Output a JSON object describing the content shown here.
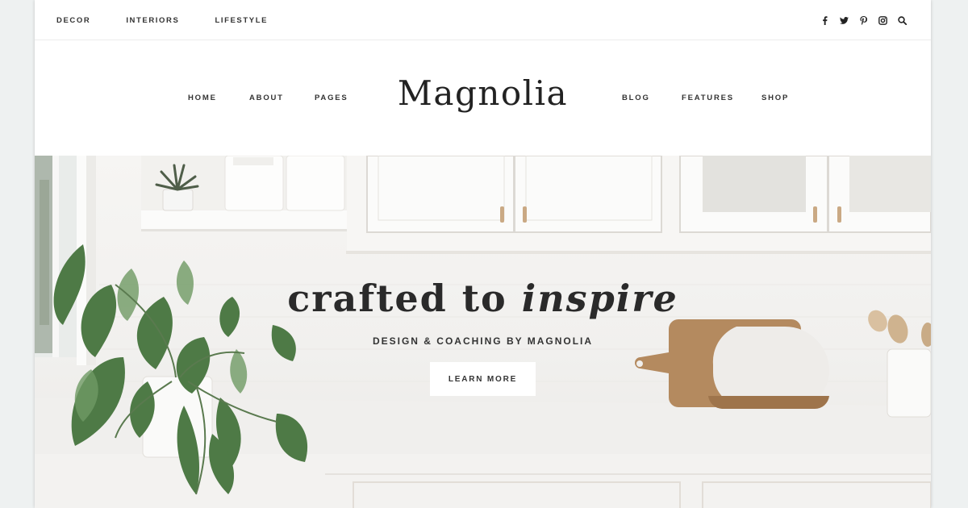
{
  "topbar": {
    "links": [
      "DECOR",
      "INTERIORS",
      "LIFESTYLE"
    ],
    "social_icons": [
      "facebook-icon",
      "twitter-icon",
      "pinterest-icon",
      "instagram-icon",
      "search-icon"
    ]
  },
  "header": {
    "logo": "Magnolia",
    "nav_left": [
      "HOME",
      "ABOUT",
      "PAGES"
    ],
    "nav_right": [
      "BLOG",
      "FEATURES",
      "SHOP"
    ]
  },
  "hero": {
    "title_plain": "crafted to ",
    "title_italic": "inspire",
    "subtitle": "DESIGN & COACHING BY MAGNOLIA",
    "button_label": "LEARN MORE"
  }
}
